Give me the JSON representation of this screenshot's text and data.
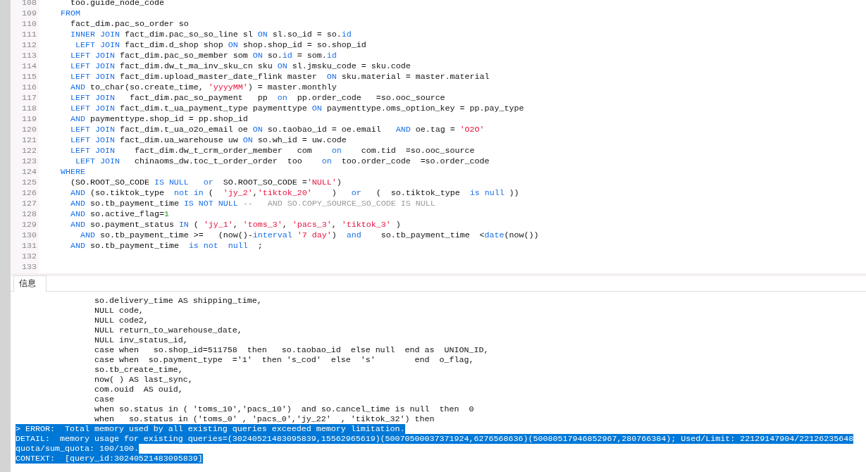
{
  "editor": {
    "lines": [
      {
        "number": "108",
        "tokens": [
          {
            "kind": "plain",
            "text": "      too.guide_node_code"
          }
        ]
      },
      {
        "number": "109",
        "tokens": [
          {
            "kind": "keyword",
            "text": "    FROM"
          }
        ]
      },
      {
        "number": "110",
        "tokens": [
          {
            "kind": "plain",
            "text": "      fact_dim.pac_so_order so"
          }
        ]
      },
      {
        "number": "111",
        "tokens": [
          {
            "kind": "keyword",
            "text": "      INNER JOIN"
          },
          {
            "kind": "plain",
            "text": " fact_dim.pac_so_so_line sl "
          },
          {
            "kind": "keyword",
            "text": "ON"
          },
          {
            "kind": "plain",
            "text": " sl.so_id = so."
          },
          {
            "kind": "keyword",
            "text": "id"
          }
        ]
      },
      {
        "number": "112",
        "tokens": [
          {
            "kind": "keyword",
            "text": "       LEFT JOIN"
          },
          {
            "kind": "plain",
            "text": " fact_dim.d_shop shop "
          },
          {
            "kind": "keyword",
            "text": "ON"
          },
          {
            "kind": "plain",
            "text": " shop.shop_id = so.shop_id"
          }
        ]
      },
      {
        "number": "113",
        "tokens": [
          {
            "kind": "keyword",
            "text": "      LEFT JOIN"
          },
          {
            "kind": "plain",
            "text": " fact_dim.pac_so_member som "
          },
          {
            "kind": "keyword",
            "text": "ON"
          },
          {
            "kind": "plain",
            "text": " so."
          },
          {
            "kind": "keyword",
            "text": "id"
          },
          {
            "kind": "plain",
            "text": " = som."
          },
          {
            "kind": "keyword",
            "text": "id"
          }
        ]
      },
      {
        "number": "114",
        "tokens": [
          {
            "kind": "keyword",
            "text": "      LEFT JOIN"
          },
          {
            "kind": "plain",
            "text": " fact_dim.dw_t_ma_inv_sku_cn sku "
          },
          {
            "kind": "keyword",
            "text": "ON"
          },
          {
            "kind": "plain",
            "text": " sl.jmsku_code = sku.code"
          }
        ]
      },
      {
        "number": "115",
        "tokens": [
          {
            "kind": "keyword",
            "text": "      LEFT JOIN"
          },
          {
            "kind": "plain",
            "text": " fact_dim.upload_master_date_flink master  "
          },
          {
            "kind": "keyword",
            "text": "ON"
          },
          {
            "kind": "plain",
            "text": " sku.material = master.material"
          }
        ]
      },
      {
        "number": "116",
        "tokens": [
          {
            "kind": "keyword",
            "text": "      AND"
          },
          {
            "kind": "plain",
            "text": " to_char(so.create_time, "
          },
          {
            "kind": "string",
            "text": "'yyyyMM'"
          },
          {
            "kind": "plain",
            "text": ") = master.monthly"
          }
        ]
      },
      {
        "number": "117",
        "tokens": [
          {
            "kind": "keyword",
            "text": "      LEFT JOIN"
          },
          {
            "kind": "plain",
            "text": "   fact_dim.pac_so_payment   pp  "
          },
          {
            "kind": "keyword",
            "text": "on"
          },
          {
            "kind": "plain",
            "text": "  pp.order_code   =so.ooc_source"
          }
        ]
      },
      {
        "number": "118",
        "tokens": [
          {
            "kind": "keyword",
            "text": "      LEFT JOIN"
          },
          {
            "kind": "plain",
            "text": " fact_dim.t_ua_payment_type paymenttype "
          },
          {
            "kind": "keyword",
            "text": "ON"
          },
          {
            "kind": "plain",
            "text": " paymenttype.oms_option_key = pp.pay_type"
          }
        ]
      },
      {
        "number": "119",
        "tokens": [
          {
            "kind": "keyword",
            "text": "      AND"
          },
          {
            "kind": "plain",
            "text": " paymenttype.shop_id = pp.shop_id"
          }
        ]
      },
      {
        "number": "120",
        "tokens": [
          {
            "kind": "keyword",
            "text": "      LEFT JOIN"
          },
          {
            "kind": "plain",
            "text": " fact_dim.t_ua_o2o_email oe "
          },
          {
            "kind": "keyword",
            "text": "ON"
          },
          {
            "kind": "plain",
            "text": " so.taobao_id = oe.email   "
          },
          {
            "kind": "keyword",
            "text": "AND"
          },
          {
            "kind": "plain",
            "text": " oe.tag = "
          },
          {
            "kind": "string",
            "text": "'O2O'"
          }
        ]
      },
      {
        "number": "121",
        "tokens": [
          {
            "kind": "keyword",
            "text": "      LEFT JOIN"
          },
          {
            "kind": "plain",
            "text": " fact_dim.ua_warehouse uw "
          },
          {
            "kind": "keyword",
            "text": "ON"
          },
          {
            "kind": "plain",
            "text": " so.wh_id = uw.code"
          }
        ]
      },
      {
        "number": "122",
        "tokens": [
          {
            "kind": "keyword",
            "text": "      LEFT JOIN"
          },
          {
            "kind": "plain",
            "text": "    fact_dim.dw_t_crm_order_member   com    "
          },
          {
            "kind": "keyword",
            "text": "on"
          },
          {
            "kind": "plain",
            "text": "    com.tid  =so.ooc_source"
          }
        ]
      },
      {
        "number": "123",
        "tokens": [
          {
            "kind": "keyword",
            "text": "       LEFT JOIN"
          },
          {
            "kind": "plain",
            "text": "   chinaoms_dw.toc_t_order_order  too    "
          },
          {
            "kind": "keyword",
            "text": "on"
          },
          {
            "kind": "plain",
            "text": "  too.order_code  =so.order_code"
          }
        ]
      },
      {
        "number": "124",
        "tokens": [
          {
            "kind": "keyword",
            "text": "    WHERE"
          }
        ]
      },
      {
        "number": "125",
        "tokens": [
          {
            "kind": "plain",
            "text": "      (SO.ROOT_SO_CODE "
          },
          {
            "kind": "keyword",
            "text": "IS NULL   "
          },
          {
            "kind": "keyword",
            "text": "or"
          },
          {
            "kind": "plain",
            "text": "  SO.ROOT_SO_CODE ="
          },
          {
            "kind": "string",
            "text": "'NULL'"
          },
          {
            "kind": "plain",
            "text": ")"
          }
        ]
      },
      {
        "number": "126",
        "tokens": [
          {
            "kind": "keyword",
            "text": "      AND"
          },
          {
            "kind": "plain",
            "text": " (so.tiktok_type  "
          },
          {
            "kind": "keyword",
            "text": "not in"
          },
          {
            "kind": "plain",
            "text": " (  "
          },
          {
            "kind": "string",
            "text": "'jy_2'"
          },
          {
            "kind": "plain",
            "text": ","
          },
          {
            "kind": "string",
            "text": "'tiktok_20'"
          },
          {
            "kind": "plain",
            "text": "    )   "
          },
          {
            "kind": "keyword",
            "text": "or"
          },
          {
            "kind": "plain",
            "text": "   (  so.tiktok_type  "
          },
          {
            "kind": "keyword",
            "text": "is null"
          },
          {
            "kind": "plain",
            "text": " ))"
          }
        ]
      },
      {
        "number": "127",
        "tokens": [
          {
            "kind": "keyword",
            "text": "      AND"
          },
          {
            "kind": "plain",
            "text": " so.tb_payment_time "
          },
          {
            "kind": "keyword",
            "text": "IS NOT NULL "
          },
          {
            "kind": "comment",
            "text": "--   AND SO.COPY_SOURCE_SO_CODE IS NULL"
          }
        ]
      },
      {
        "number": "128",
        "tokens": [
          {
            "kind": "keyword",
            "text": "      AND"
          },
          {
            "kind": "plain",
            "text": " so.active_flag="
          },
          {
            "kind": "number",
            "text": "1"
          }
        ]
      },
      {
        "number": "129",
        "tokens": [
          {
            "kind": "keyword",
            "text": "      AND"
          },
          {
            "kind": "plain",
            "text": " so.payment_status "
          },
          {
            "kind": "keyword",
            "text": "IN"
          },
          {
            "kind": "plain",
            "text": " ( "
          },
          {
            "kind": "string",
            "text": "'jy_1'"
          },
          {
            "kind": "plain",
            "text": ", "
          },
          {
            "kind": "string",
            "text": "'toms_3'"
          },
          {
            "kind": "plain",
            "text": ", "
          },
          {
            "kind": "string",
            "text": "'pacs_3'"
          },
          {
            "kind": "plain",
            "text": ", "
          },
          {
            "kind": "string",
            "text": "'tiktok_3'"
          },
          {
            "kind": "plain",
            "text": " )"
          }
        ]
      },
      {
        "number": "130",
        "tokens": [
          {
            "kind": "keyword",
            "text": "        AND"
          },
          {
            "kind": "plain",
            "text": " so.tb_payment_time >=   (now()-"
          },
          {
            "kind": "keyword",
            "text": "interval "
          },
          {
            "kind": "string",
            "text": "'7 day'"
          },
          {
            "kind": "plain",
            "text": ")  "
          },
          {
            "kind": "keyword",
            "text": "and"
          },
          {
            "kind": "plain",
            "text": "    so.tb_payment_time  <"
          },
          {
            "kind": "keyword",
            "text": "date"
          },
          {
            "kind": "plain",
            "text": "(now())"
          }
        ]
      },
      {
        "number": "131",
        "tokens": [
          {
            "kind": "keyword",
            "text": "      AND"
          },
          {
            "kind": "plain",
            "text": " so.tb_payment_time  "
          },
          {
            "kind": "keyword",
            "text": "is not  "
          },
          {
            "kind": "keyword",
            "text": "null"
          },
          {
            "kind": "plain",
            "text": "  ;"
          }
        ]
      },
      {
        "number": "132"
      },
      {
        "number": "133"
      }
    ]
  },
  "tabs": [
    {
      "label": "信息",
      "selected": true
    }
  ],
  "output": {
    "lines": [
      {
        "text": "                so.delivery_time AS shipping_time,",
        "selected": false
      },
      {
        "text": "                NULL code,",
        "selected": false
      },
      {
        "text": "                NULL code2,",
        "selected": false
      },
      {
        "text": "                NULL return_to_warehouse_date,",
        "selected": false
      },
      {
        "text": "                NULL inv_status_id,",
        "selected": false
      },
      {
        "text": "                case when   so.shop_id=511758  then   so.taobao_id  else null  end as  UNION_ID,",
        "selected": false
      },
      {
        "text": "                case when  so.payment_type  ='1'  then 's_cod'  else  's'        end  o_flag,",
        "selected": false
      },
      {
        "text": "                so.tb_create_time,",
        "selected": false
      },
      {
        "text": "                now( ) AS last_sync,",
        "selected": false
      },
      {
        "text": "                com.ouid  AS ouid,",
        "selected": false
      },
      {
        "text": "                case",
        "selected": false
      },
      {
        "text": "                when so.status in ( 'toms_10','pacs_10')  and so.cancel_time is null  then  0",
        "selected": false
      },
      {
        "text": "                when   so.status in ('toms_0' , 'pacs_0','jy_22'  , 'tiktok_32') then",
        "selected": false
      },
      {
        "text": "> ERROR:  Total memory used by all existing queries exceeded memory limitation.",
        "selected": true
      },
      {
        "text": "DETAIL:  memory usage for existing queries=(30240521483095839,15562965619)(50070500037371924,6276568636)(50080517946852967,280766384); Used/Limit: 22129147904/22126235648",
        "selected": true
      },
      {
        "text": "quota/sum_quota: 100/100.",
        "selected": true
      },
      {
        "text": "CONTEXT:  [query_id:30240521483095839]",
        "selected": true
      }
    ]
  }
}
